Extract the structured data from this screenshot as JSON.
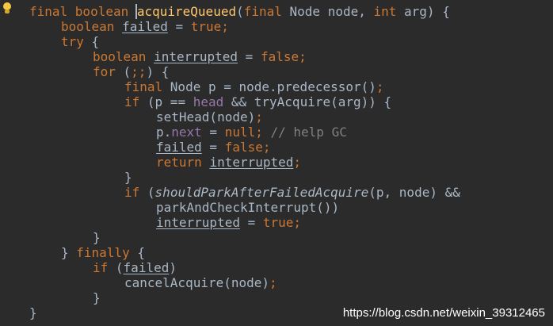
{
  "editor": {
    "code_lines": [
      {
        "indent": 0,
        "tokens": [
          {
            "t": "final boolean ",
            "cls": "k"
          },
          {
            "t": "acquireQueued",
            "cls": "f cursor"
          },
          {
            "t": "(",
            "cls": ""
          },
          {
            "t": "final ",
            "cls": "k"
          },
          {
            "t": "Node node, ",
            "cls": ""
          },
          {
            "t": "int ",
            "cls": "k"
          },
          {
            "t": "arg) {",
            "cls": ""
          }
        ]
      },
      {
        "indent": 1,
        "tokens": [
          {
            "t": "boolean ",
            "cls": "k"
          },
          {
            "t": "failed",
            "cls": "u"
          },
          {
            "t": " = ",
            "cls": ""
          },
          {
            "t": "true",
            "cls": "k"
          },
          {
            "t": ";",
            "cls": "k"
          }
        ]
      },
      {
        "indent": 1,
        "tokens": [
          {
            "t": "try ",
            "cls": "k"
          },
          {
            "t": "{",
            "cls": ""
          }
        ]
      },
      {
        "indent": 2,
        "tokens": [
          {
            "t": "boolean ",
            "cls": "k"
          },
          {
            "t": "interrupted",
            "cls": "u"
          },
          {
            "t": " = ",
            "cls": ""
          },
          {
            "t": "false",
            "cls": "k"
          },
          {
            "t": ";",
            "cls": "k"
          }
        ]
      },
      {
        "indent": 2,
        "tokens": [
          {
            "t": "for ",
            "cls": "k"
          },
          {
            "t": "(",
            "cls": ""
          },
          {
            "t": ";;",
            "cls": "k"
          },
          {
            "t": ") {",
            "cls": ""
          }
        ]
      },
      {
        "indent": 3,
        "tokens": [
          {
            "t": "final ",
            "cls": "k"
          },
          {
            "t": "Node p = node.predecessor()",
            "cls": ""
          },
          {
            "t": ";",
            "cls": "k"
          }
        ]
      },
      {
        "indent": 3,
        "tokens": [
          {
            "t": "if ",
            "cls": "k"
          },
          {
            "t": "(p == ",
            "cls": ""
          },
          {
            "t": "head",
            "cls": "fld"
          },
          {
            "t": " && tryAcquire(arg)) {",
            "cls": ""
          }
        ]
      },
      {
        "indent": 4,
        "tokens": [
          {
            "t": "setHead(node)",
            "cls": ""
          },
          {
            "t": ";",
            "cls": "k"
          }
        ]
      },
      {
        "indent": 4,
        "tokens": [
          {
            "t": "p.",
            "cls": ""
          },
          {
            "t": "next",
            "cls": "fld"
          },
          {
            "t": " = ",
            "cls": ""
          },
          {
            "t": "null",
            "cls": "k"
          },
          {
            "t": ";",
            "cls": "k"
          },
          {
            "t": " // help GC",
            "cls": "c"
          }
        ]
      },
      {
        "indent": 4,
        "tokens": [
          {
            "t": "failed",
            "cls": "u"
          },
          {
            "t": " = ",
            "cls": ""
          },
          {
            "t": "false",
            "cls": "k"
          },
          {
            "t": ";",
            "cls": "k"
          }
        ]
      },
      {
        "indent": 4,
        "tokens": [
          {
            "t": "return ",
            "cls": "k"
          },
          {
            "t": "interrupted",
            "cls": "u"
          },
          {
            "t": ";",
            "cls": "k"
          }
        ]
      },
      {
        "indent": 3,
        "tokens": [
          {
            "t": "}",
            "cls": ""
          }
        ]
      },
      {
        "indent": 3,
        "tokens": [
          {
            "t": "if ",
            "cls": "k"
          },
          {
            "t": "(",
            "cls": ""
          },
          {
            "t": "shouldParkAfterFailedAcquire",
            "cls": "it"
          },
          {
            "t": "(p, node) &&",
            "cls": ""
          }
        ]
      },
      {
        "indent": 4,
        "tokens": [
          {
            "t": "parkAndCheckInterrupt())",
            "cls": ""
          }
        ]
      },
      {
        "indent": 4,
        "tokens": [
          {
            "t": "interrupted",
            "cls": "u"
          },
          {
            "t": " = ",
            "cls": ""
          },
          {
            "t": "true",
            "cls": "k"
          },
          {
            "t": ";",
            "cls": "k"
          }
        ]
      },
      {
        "indent": 2,
        "tokens": [
          {
            "t": "}",
            "cls": ""
          }
        ]
      },
      {
        "indent": 1,
        "tokens": [
          {
            "t": "} ",
            "cls": ""
          },
          {
            "t": "finally ",
            "cls": "k"
          },
          {
            "t": "{",
            "cls": ""
          }
        ]
      },
      {
        "indent": 2,
        "tokens": [
          {
            "t": "if ",
            "cls": "k"
          },
          {
            "t": "(",
            "cls": ""
          },
          {
            "t": "failed",
            "cls": "u"
          },
          {
            "t": ")",
            "cls": ""
          }
        ]
      },
      {
        "indent": 3,
        "tokens": [
          {
            "t": "cancelAcquire(node)",
            "cls": ""
          },
          {
            "t": ";",
            "cls": "k"
          }
        ]
      },
      {
        "indent": 2,
        "tokens": [
          {
            "t": "}",
            "cls": ""
          }
        ]
      },
      {
        "indent": 0,
        "tokens": [
          {
            "t": "}",
            "cls": ""
          }
        ]
      }
    ]
  },
  "gutter": {
    "intention_icon": "lightbulb-icon"
  },
  "watermark": {
    "text": "https://blog.csdn.net/weixin_39312465"
  },
  "colors": {
    "background": "#2b2b2b",
    "keyword": "#cc7832",
    "method_declaration": "#ffc66d",
    "field": "#9876aa",
    "comment": "#808080",
    "default_text": "#a9b7c6",
    "intention_bulb": "#f5c842"
  }
}
